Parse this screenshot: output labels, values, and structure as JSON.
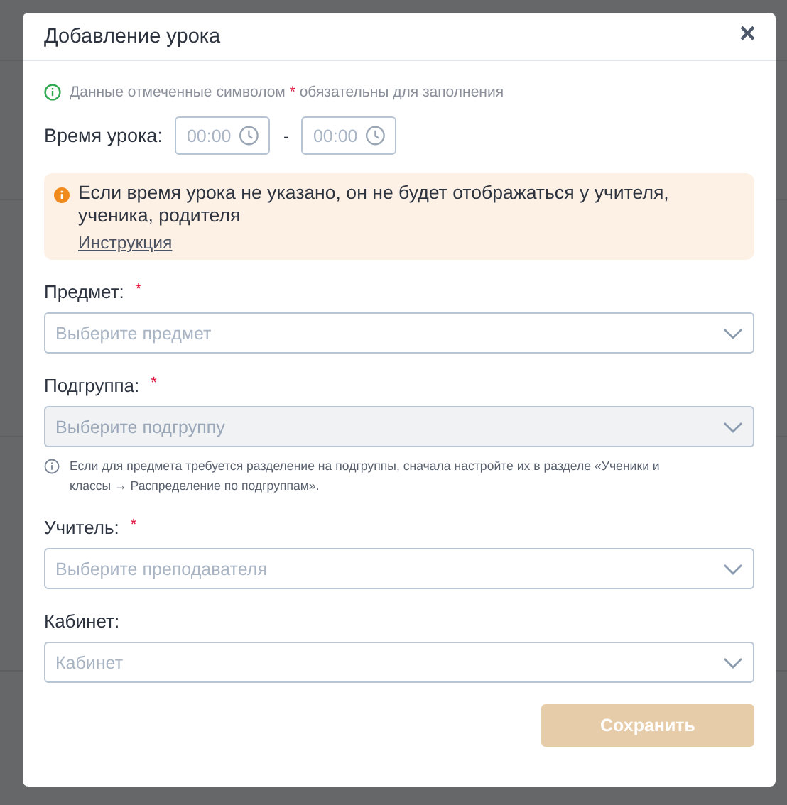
{
  "dialog": {
    "title": "Добавление урока",
    "close": "×"
  },
  "required_note": {
    "before": "Данные отмеченные символом",
    "mark": "*",
    "after": "обязательны для заполнения"
  },
  "time": {
    "label": "Время урока:",
    "start_placeholder": "00:00",
    "separator": "-",
    "end_placeholder": "00:00"
  },
  "alert": {
    "text": "Если время урока не указано, он не будет отображаться у учителя, ученика, родителя",
    "link": "Инструкция"
  },
  "fields": [
    {
      "label": "Предмет:",
      "required_mark": "*",
      "placeholder": "Выберите предмет",
      "disabled": false
    },
    {
      "label": "Подгруппа:",
      "required_mark": "*",
      "placeholder": "Выберите подгруппу",
      "disabled": true,
      "hint": "Если для предмета требуется разделение на подгруппы, сначала настройте их в разделе «Ученики и классы → Распределение по подгруппам»."
    },
    {
      "label": "Учитель:",
      "required_mark": "*",
      "placeholder": "Выберите преподавателя",
      "disabled": false
    },
    {
      "label": "Кабинет:",
      "placeholder": "Кабинет",
      "disabled": false
    }
  ],
  "save_button": {
    "label": "Сохранить",
    "disabled": true
  }
}
